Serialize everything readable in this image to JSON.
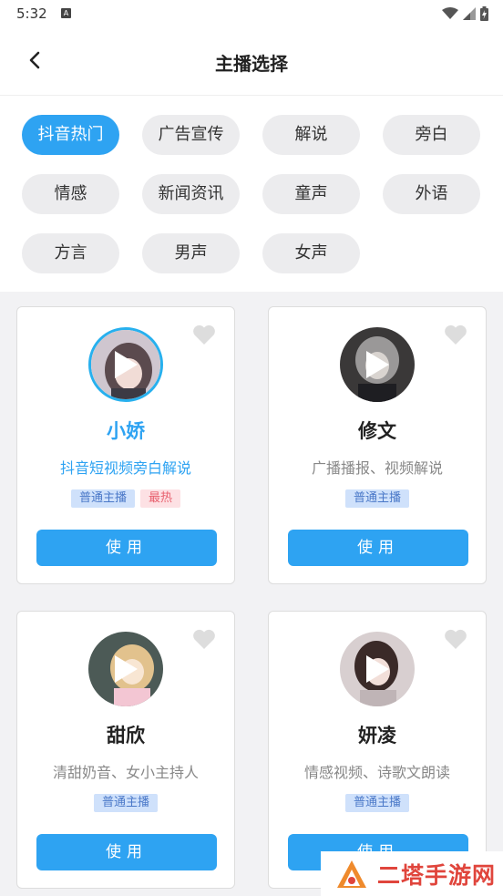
{
  "status_bar": {
    "time": "5:32",
    "notification_badge": "A",
    "icons": [
      "wifi-icon",
      "signal-icon",
      "battery-icon"
    ]
  },
  "header": {
    "title": "主播选择",
    "back_icon": "chevron-left-icon"
  },
  "categories": [
    {
      "label": "抖音热门",
      "active": true
    },
    {
      "label": "广告宣传",
      "active": false
    },
    {
      "label": "解说",
      "active": false
    },
    {
      "label": "旁白",
      "active": false
    },
    {
      "label": "情感",
      "active": false
    },
    {
      "label": "新闻资讯",
      "active": false
    },
    {
      "label": "童声",
      "active": false
    },
    {
      "label": "外语",
      "active": false
    },
    {
      "label": "方言",
      "active": false
    },
    {
      "label": "男声",
      "active": false
    },
    {
      "label": "女声",
      "active": false
    }
  ],
  "anchors": [
    {
      "name": "小娇",
      "desc": "抖音短视频旁白解说",
      "tags": [
        {
          "label": "普通主播",
          "kind": "normal"
        },
        {
          "label": "最热",
          "kind": "hot"
        }
      ],
      "use_label": "使用",
      "selected": true
    },
    {
      "name": "修文",
      "desc": "广播播报、视频解说",
      "tags": [
        {
          "label": "普通主播",
          "kind": "normal"
        }
      ],
      "use_label": "使用",
      "selected": false
    },
    {
      "name": "甜欣",
      "desc": "清甜奶音、女小主持人",
      "tags": [
        {
          "label": "普通主播",
          "kind": "normal"
        }
      ],
      "use_label": "使用",
      "selected": false
    },
    {
      "name": "妍凌",
      "desc": "情感视频、诗歌文朗读",
      "tags": [
        {
          "label": "普通主播",
          "kind": "normal"
        }
      ],
      "use_label": "使用",
      "selected": false
    }
  ],
  "watermark": {
    "text": "二塔手游网"
  },
  "colors": {
    "accent": "#2ea3f2",
    "hot_tag": "#e8616f",
    "normal_tag": "#4a78c8"
  }
}
